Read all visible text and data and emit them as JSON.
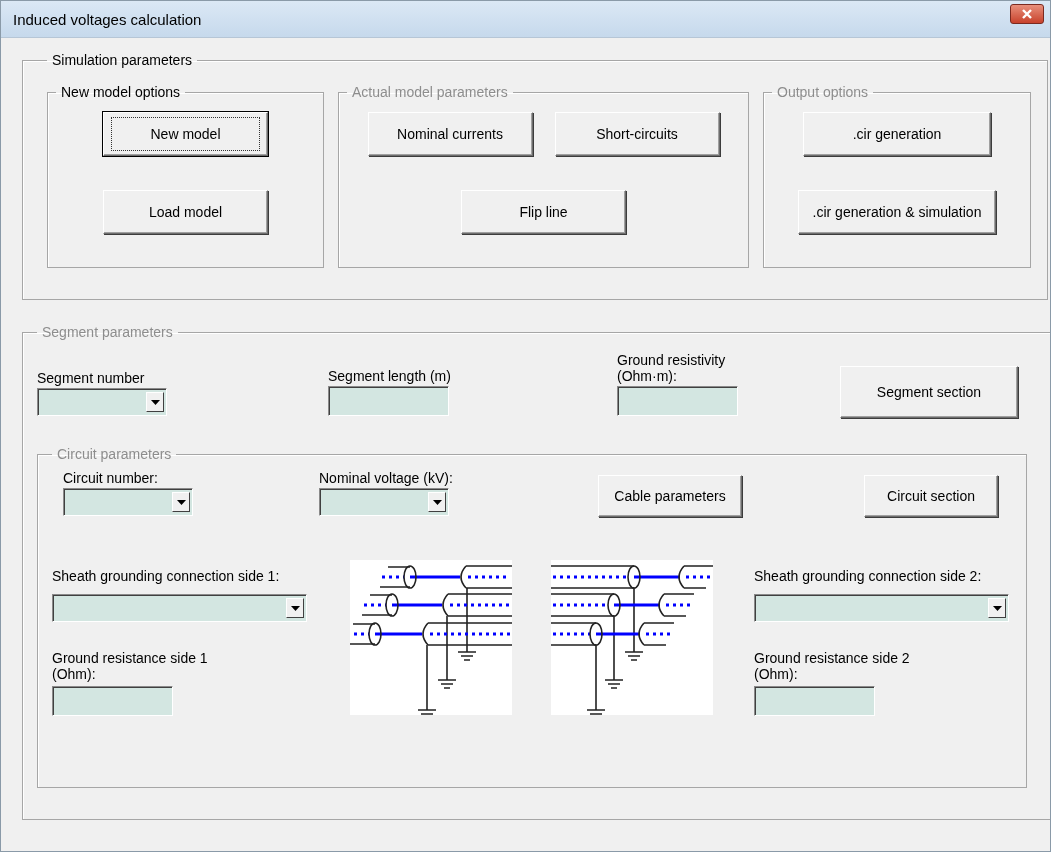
{
  "window": {
    "title": "Induced voltages calculation"
  },
  "simulation": {
    "legend": "Simulation parameters",
    "groups": [
      {
        "legend": "New model options",
        "disabled": false,
        "buttons": [
          {
            "label": "New model",
            "focused": true
          },
          {
            "label": "Load model",
            "focused": false
          }
        ]
      },
      {
        "legend": "Actual model parameters",
        "disabled": true,
        "buttons": [
          {
            "label": "Nominal currents",
            "focused": false
          },
          {
            "label": "Short-circuits",
            "focused": false
          },
          {
            "label": "Flip line",
            "focused": false
          }
        ]
      },
      {
        "legend": "Output options",
        "disabled": true,
        "buttons": [
          {
            "label": ".cir generation",
            "focused": false
          },
          {
            "label": ".cir generation & simulation",
            "focused": false
          }
        ]
      }
    ]
  },
  "segment": {
    "legend": "Segment parameters",
    "disabled": true,
    "fields": [
      {
        "kind": "combo",
        "label": "Segment number"
      },
      {
        "kind": "text",
        "label": "Segment length (m)"
      },
      {
        "kind": "text",
        "label": "Ground resistivity (Ohm·m):"
      }
    ],
    "button": "Segment section",
    "circuit": {
      "legend": "Circuit parameters",
      "disabled": true,
      "fields": [
        {
          "kind": "combo",
          "label": "Circuit number:"
        },
        {
          "kind": "combo",
          "label": "Nominal voltage (kV):"
        }
      ],
      "buttons": [
        "Cable parameters",
        "Circuit section"
      ],
      "sides": [
        {
          "grounding_label": "Sheath grounding connection side 1:",
          "resistance_label": "Ground resistance side 1 (Ohm):"
        },
        {
          "grounding_label": "Sheath grounding connection side 2:",
          "resistance_label": "Ground resistance side 2 (Ohm):"
        }
      ]
    }
  }
}
